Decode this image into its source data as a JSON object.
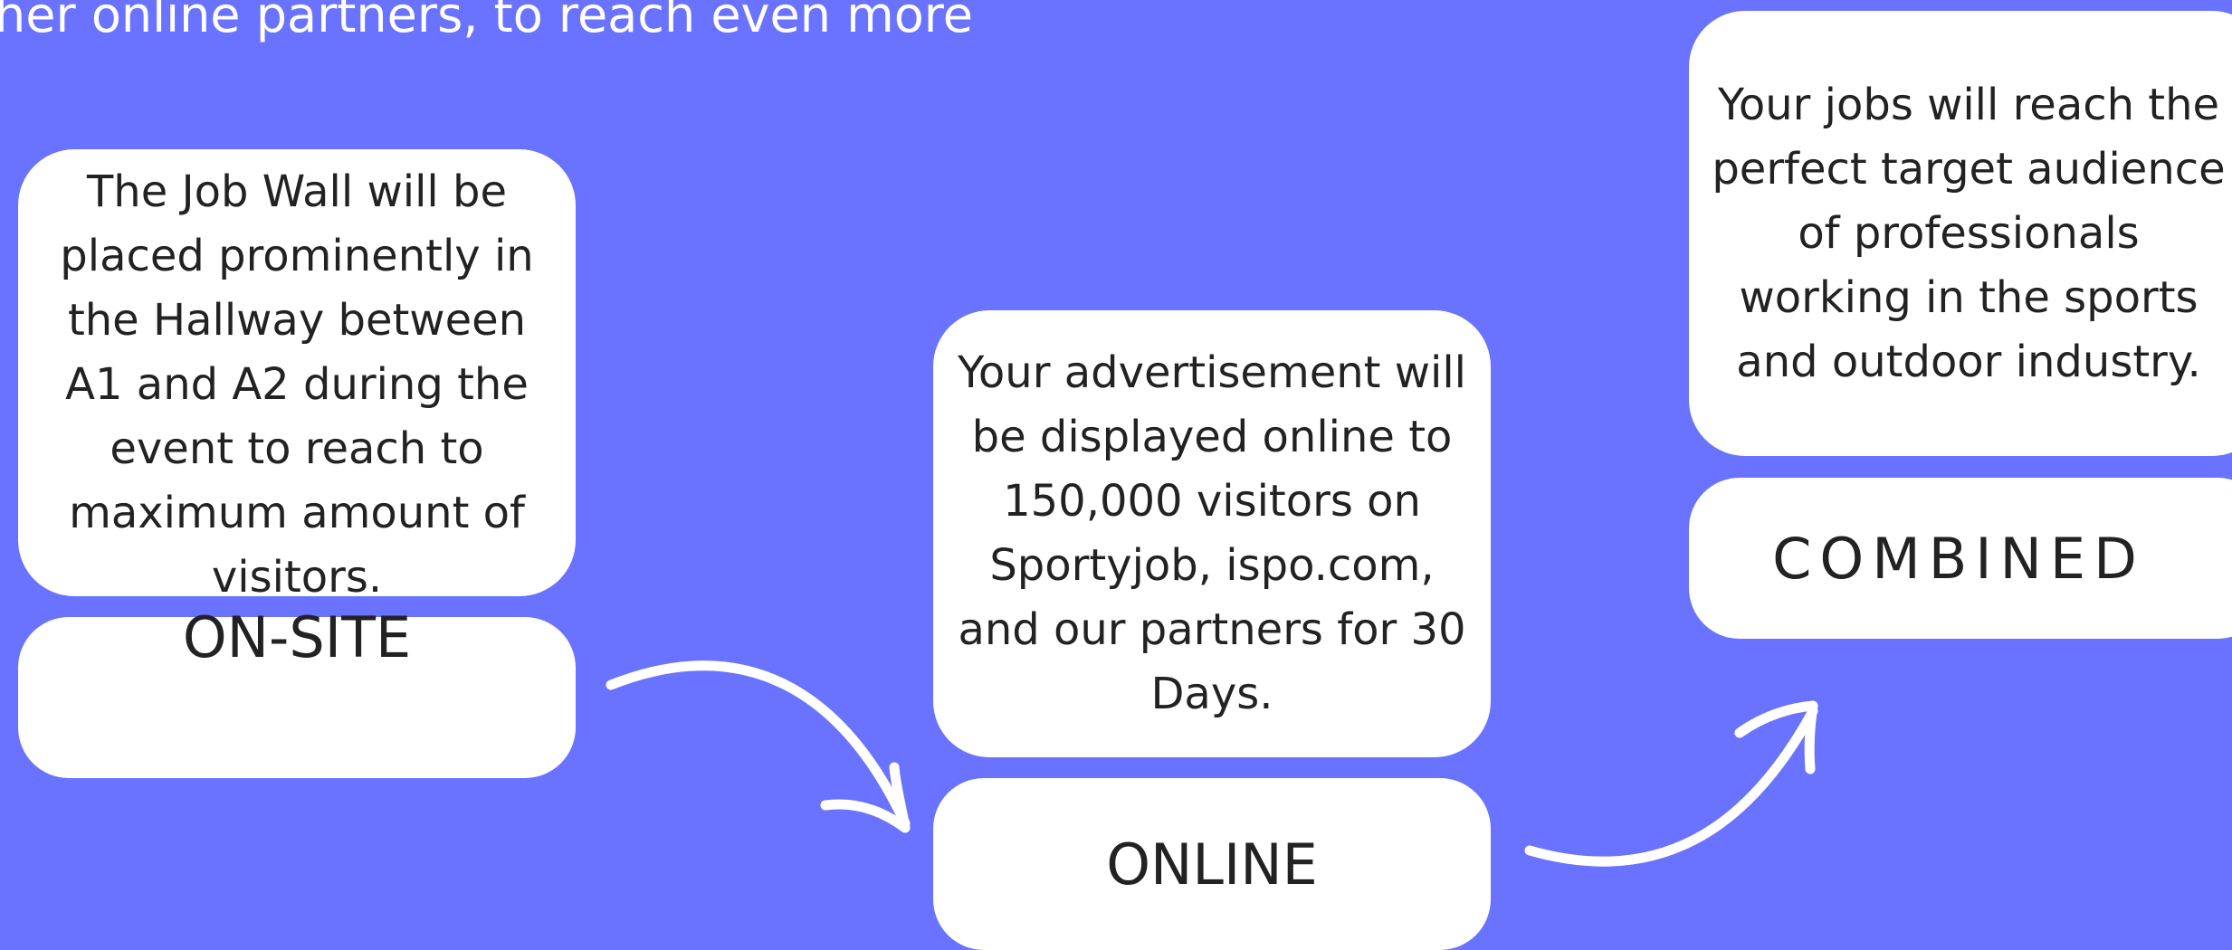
{
  "intro_text": "her online partners, to reach even more",
  "colors": {
    "background": "#6a73ff",
    "card": "#ffffff",
    "text": "#222222"
  },
  "steps": [
    {
      "label": "ON-SITE",
      "description": "The Job Wall will be placed prominently in the Hallway between A1 and A2 during the event to reach to maximum amount of visitors."
    },
    {
      "label": "ONLINE",
      "description": "Your advertisement will be displayed online to 150,000 visitors on Sportyjob, ispo.com, and our partners for 30 Days."
    },
    {
      "label": "COMBINED",
      "description": "Your jobs will reach the perfect target audience of professionals working in the sports and outdoor industry."
    }
  ],
  "icons": {
    "arrow_1": "curved-arrow-down-right",
    "arrow_2": "curved-arrow-up-right"
  }
}
